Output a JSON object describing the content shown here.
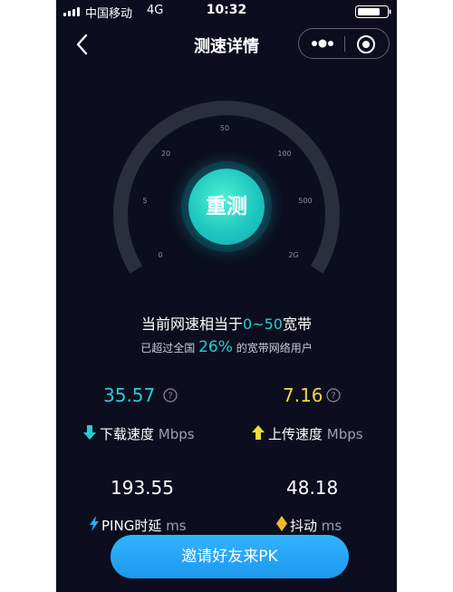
{
  "status_bar": {
    "carrier": "中国移动",
    "network": "4G",
    "time": "10:32"
  },
  "nav": {
    "title": "测速详情",
    "icons": [
      "back-chevron-icon",
      "more-dots-icon",
      "close-target-icon"
    ]
  },
  "gauge": {
    "ticks": [
      "0",
      "5",
      "20",
      "50",
      "100",
      "500",
      "2G"
    ],
    "retest_label": "重测",
    "colors": {
      "track": "#2b2e3d",
      "button": "#1ec8bf"
    }
  },
  "summary": {
    "line1_prefix": "当前网速相当于",
    "line1_value": "0~50",
    "line1_suffix": "宽带",
    "line2_prefix": "已超过全国",
    "line2_value": "26%",
    "line2_suffix": "的宽带网络用户"
  },
  "metrics": {
    "download": {
      "value": "35.57",
      "label": "下载速度",
      "unit": "Mbps",
      "color": "#22d0d3"
    },
    "upload": {
      "value": "7.16",
      "label": "上传速度",
      "unit": "Mbps",
      "color": "#f2d93a"
    },
    "ping": {
      "value": "193.55",
      "label": "PING时延",
      "unit": "ms"
    },
    "jitter": {
      "value": "48.18",
      "label": "抖动",
      "unit": "ms"
    }
  },
  "invite_button": {
    "label": "邀请好友来PK",
    "color": "#1f98ee"
  }
}
